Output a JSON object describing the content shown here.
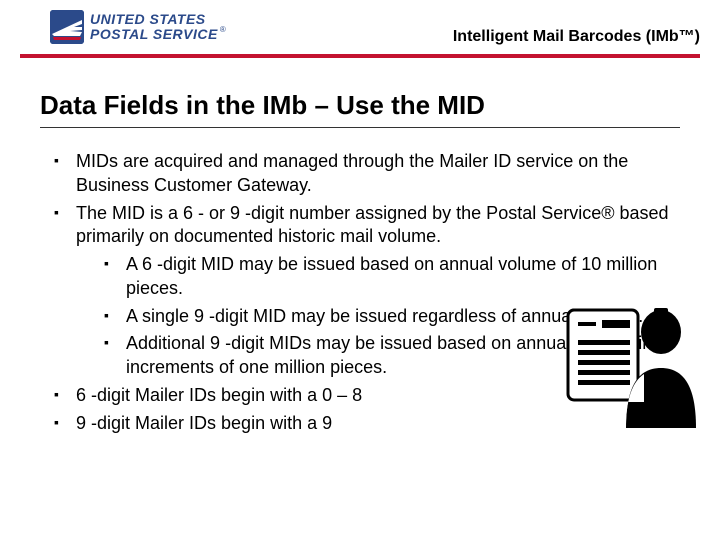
{
  "brand": {
    "line1": "UNITED STATES",
    "line2": "POSTAL SERVICE",
    "registered": "®"
  },
  "header_title": "Intelligent Mail Barcodes (IMb™)",
  "slide_title": "Data Fields in the IMb – Use the MID",
  "bullets": {
    "b1": "MIDs are acquired and managed through the Mailer ID service on the Business Customer Gateway.",
    "b2": "The MID is a 6 - or 9 -digit number assigned by the Postal Service® based primarily on documented historic mail volume.",
    "b2_sub": {
      "s1": "A 6 -digit MID may be issued based on annual volume of 10 million pieces.",
      "s2": "A single 9 -digit MID may be issued regardless of annual volume.",
      "s3": "Additional 9 -digit MIDs may be issued based on annual volume in increments of one million pieces."
    },
    "b3": "6 -digit Mailer IDs begin with a 0 – 8",
    "b4": "9 -digit Mailer IDs begin with a 9"
  }
}
